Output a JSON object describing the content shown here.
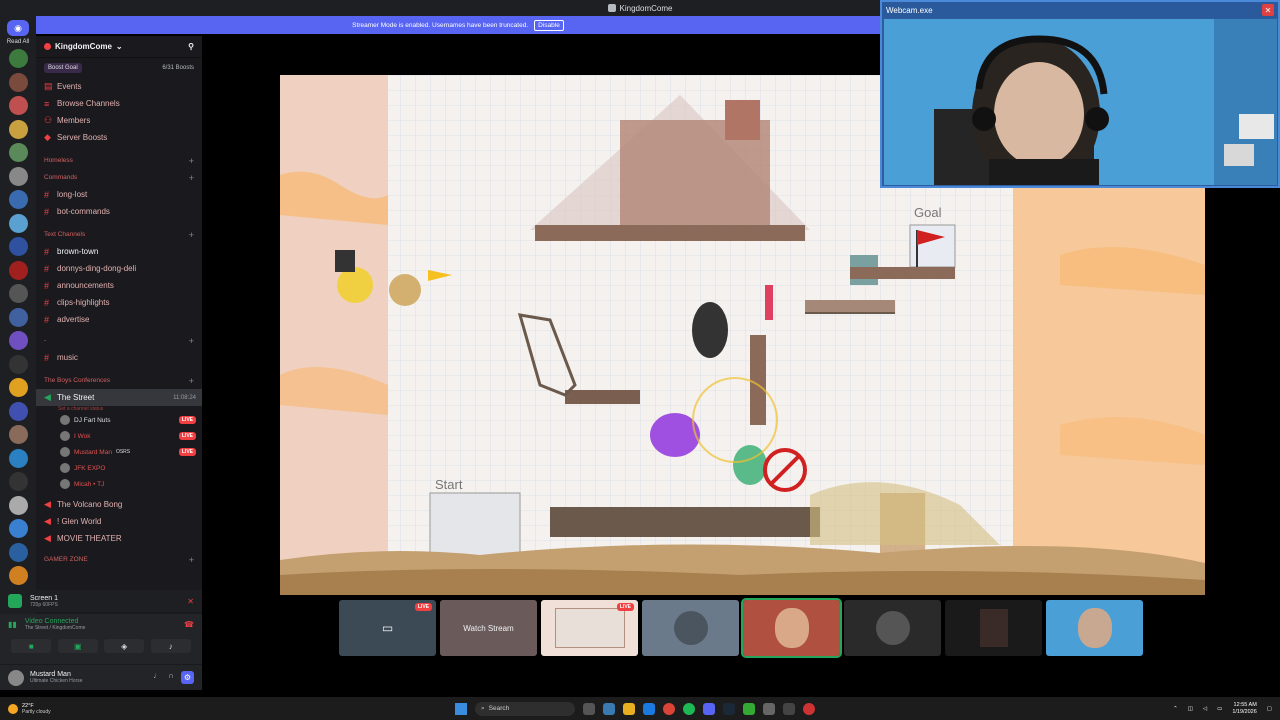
{
  "titlebar": {
    "title": "KingdomCome"
  },
  "rail": {
    "home_label": "Read All"
  },
  "server": {
    "name": "KingdomCome",
    "boost_label": "Boost Goal",
    "boost_count": "6/31 Boosts"
  },
  "top_items": [
    {
      "label": "Events"
    },
    {
      "label": "Browse Channels"
    },
    {
      "label": "Members"
    },
    {
      "label": "Server Boosts"
    }
  ],
  "categories": {
    "homeless": "Homeless",
    "commands": "Commands",
    "text": "Text Channels",
    "unnamed": "-",
    "boys": "The Boys Conferences",
    "gamer": "GAMER ZONE"
  },
  "channels": {
    "long_lost": "long-lost",
    "bot_commands": "bot-commands",
    "brown_town": "brown-town",
    "donnys": "donnys-ding-dong-deli",
    "announcements": "announcements",
    "clips": "clips-highlights",
    "advertise": "advertise",
    "music": "music"
  },
  "voice": {
    "street_name": "The Street",
    "street_time": "11:08:24",
    "street_status": "Set a channel status",
    "users": [
      {
        "name": "DJ Fart Nuts",
        "live": "LIVE"
      },
      {
        "name": "I Wok",
        "live": "LIVE"
      },
      {
        "name": "Mustard Man",
        "badge": "OSRS",
        "live": "LIVE"
      },
      {
        "name": "JFK EXPO"
      },
      {
        "name": "Micah • TJ"
      }
    ],
    "volcano": "The Volcano Bong",
    "glen": "! Glen World",
    "movie": "MOVIE THEATER"
  },
  "screen_panel": {
    "title": "Screen 1",
    "sub": "720p 60FPS"
  },
  "vc_panel": {
    "title": "Video Connected",
    "sub": "The Street / KingdomCome"
  },
  "user_panel": {
    "name": "Mustard Man",
    "status": "Ultimate Chicken Horse"
  },
  "banner": {
    "text": "Streamer Mode is enabled. Usernames have been truncated.",
    "disable": "Disable"
  },
  "game": {
    "start_label": "Start",
    "goal_label": "Goal"
  },
  "webcam": {
    "title": "Webcam.exe",
    "close": "✕"
  },
  "tiles": [
    {
      "live": "LIVE",
      "label": ""
    },
    {
      "label": "Watch Stream"
    },
    {
      "live": "LIVE",
      "label": ""
    },
    {
      "label": ""
    },
    {
      "label": ""
    },
    {
      "label": ""
    },
    {
      "label": ""
    },
    {
      "label": ""
    }
  ],
  "taskbar": {
    "temp": "22°F",
    "weather": "Partly cloudy",
    "search_placeholder": "Search",
    "time": "12:55 AM",
    "date": "1/19/2026"
  },
  "colors": {
    "accent": "#5865f2",
    "live": "#f23f42",
    "online": "#23a55a"
  }
}
